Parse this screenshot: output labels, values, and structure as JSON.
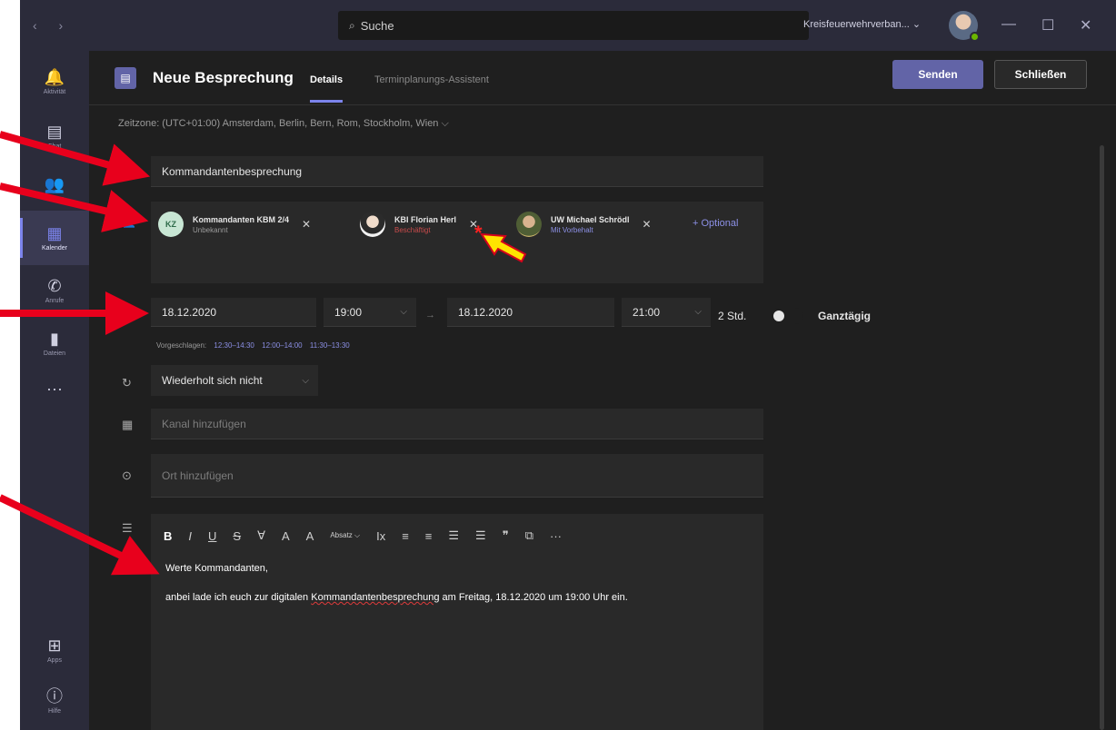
{
  "titlebar": {
    "nav_arrows": "‹ ›",
    "search_placeholder": "Suche",
    "tenant": "Kreisfeuerwehrverban... ⌄",
    "minimize": "—",
    "maximize": "☐",
    "close": "✕"
  },
  "rail": {
    "items": [
      {
        "label": "Aktivität",
        "icon": "bell-icon",
        "glyph": "🔔"
      },
      {
        "label": "Chat",
        "icon": "chat-icon",
        "glyph": "▤"
      },
      {
        "label": "Teams",
        "icon": "teams-icon",
        "glyph": "👥"
      },
      {
        "label": "Kalender",
        "icon": "calendar-icon",
        "glyph": "▦"
      },
      {
        "label": "Anrufe",
        "icon": "phone-icon",
        "glyph": "✆"
      },
      {
        "label": "Dateien",
        "icon": "file-icon",
        "glyph": "▮"
      }
    ],
    "more": "···",
    "apps_label": "Apps",
    "help_label": "Hilfe"
  },
  "header": {
    "title": "Neue Besprechung",
    "tab_details": "Details",
    "tab_scheduler": "Terminplanungs-Assistent",
    "send_label": "Senden",
    "close_label": "Schließen"
  },
  "timezone": "Zeitzone: (UTC+01:00) Amsterdam, Berlin, Bern, Rom, Stockholm, Wien ⌵",
  "form": {
    "title_value": "Kommandantenbesprechung",
    "attendees": [
      {
        "initials": "KZ",
        "name": "Kommandanten KBM 2/4",
        "status": "Unbekannt"
      },
      {
        "name": "KBI Florian Herl",
        "status": "Beschäftigt"
      },
      {
        "name": "UW Michael Schrödl",
        "status": "Mit Vorbehalt"
      }
    ],
    "optional_label": "+ Optional",
    "busy_marker": "*",
    "start_date": "18.12.2020",
    "start_time": "19:00",
    "end_date": "18.12.2020",
    "end_time": "21:00",
    "arrow": "→",
    "duration": "2 Std.",
    "all_day_label": "Ganztägig",
    "suggested_label": "Vorgeschlagen:",
    "suggested_slots": [
      "12:30–14:30",
      "12:00–14:00",
      "11:30–13:30"
    ],
    "recurrence": "Wiederholt sich nicht",
    "channel_placeholder": "Kanal hinzufügen",
    "location_placeholder": "Ort hinzufügen"
  },
  "editor": {
    "toolbar": [
      "B",
      "I",
      "U",
      "S",
      "∀",
      "A",
      "A",
      "Absatz ⌵",
      "Ix",
      "≡",
      "≡",
      "☰",
      "☰",
      "❞",
      "⧉",
      "···"
    ],
    "greeting": "Werte Kommandanten,",
    "body_prefix": "anbei lade ich euch zur digitalen ",
    "body_word": "Kommandantenbesprechung",
    "body_suffix": " am Freitag, 18.12.2020 um 19:00 Uhr ein."
  },
  "colors": {
    "accent": "#6264a7",
    "annotation_red": "#e8001c",
    "annotation_yellow": "#ffe400"
  }
}
